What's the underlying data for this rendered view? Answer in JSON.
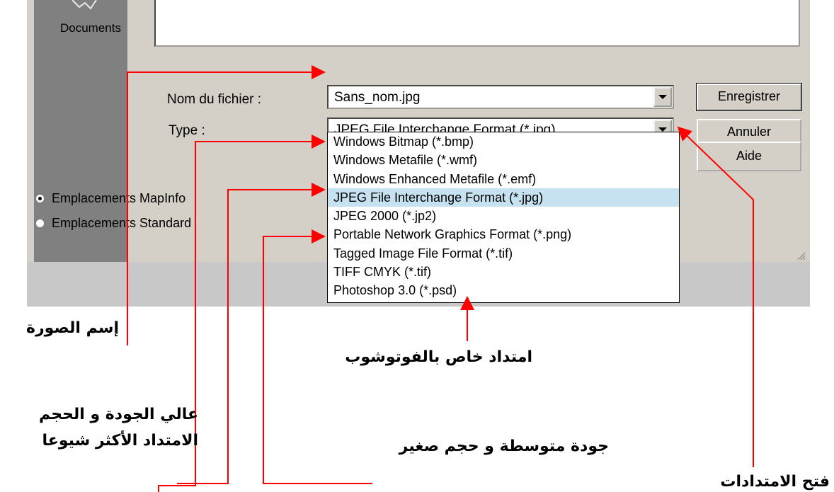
{
  "places_bar": {
    "items": [
      {
        "label": "Documents",
        "icon": "documents-icon"
      }
    ]
  },
  "form": {
    "filename_label": "Nom du fichier :",
    "filename_value": "Sans_nom.jpg",
    "type_label": "Type :",
    "type_value": "JPEG File Interchange Format (*.jpg)"
  },
  "buttons": {
    "save": "Enregistrer",
    "cancel": "Annuler",
    "help": "Aide"
  },
  "locations": {
    "mapinfo": {
      "label": "Emplacements MapInfo",
      "selected": true
    },
    "standard": {
      "label": "Emplacements Standard",
      "selected": false
    }
  },
  "type_options": [
    "Windows Bitmap (*.bmp)",
    "Windows Metafile (*.wmf)",
    "Windows Enhanced Metafile (*.emf)",
    "JPEG File Interchange Format (*.jpg)",
    "JPEG 2000 (*.jp2)",
    "Portable Network Graphics Format (*.png)",
    "Tagged Image File Format (*.tif)",
    "TIFF CMYK (*.tif)",
    "Photoshop 3.0 (*.psd)"
  ],
  "selected_option_index": 3,
  "annotations": {
    "image_name": "إسم الصورة",
    "photoshop_ext": "امتداد خاص بالفوتوشوب",
    "high_quality_line1": "عالي الجودة و الحجم",
    "most_common": "الامتداد الأكثر شيوعا",
    "medium_quality": "جودة متوسطة و حجم صغير",
    "open_extensions": "فتح الامتدادات"
  },
  "colors": {
    "annotation_line": "#ff0000",
    "dialog_bg": "#d4d0c8",
    "selection": "#c6e1ef"
  }
}
